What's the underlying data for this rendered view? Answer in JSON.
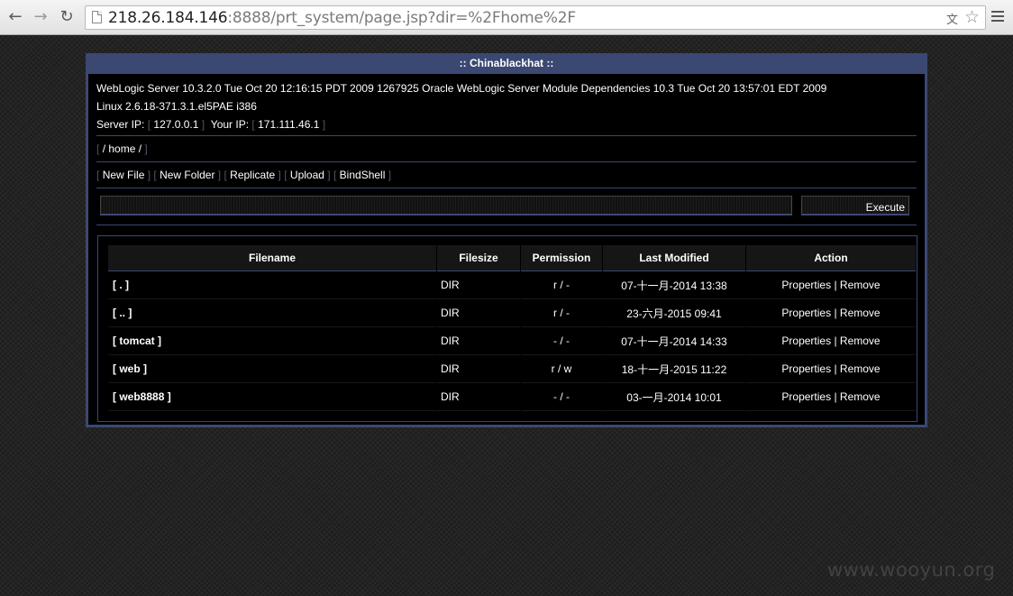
{
  "browser": {
    "url_host": "218.26.184.146",
    "url_rest": ":8888/prt_system/page.jsp?dir=%2Fhome%2F"
  },
  "panel": {
    "title": ":: Chinablackhat ::",
    "server_info": "WebLogic Server 10.3.2.0 Tue Oct 20 12:16:15 PDT 2009 1267925 Oracle WebLogic Server Module Dependencies 10.3 Tue Oct 20 13:57:01 EDT 2009",
    "os_info": "Linux 2.6.18-371.3.1.el5PAE i386",
    "server_ip_label": "Server IP:",
    "server_ip": "127.0.0.1",
    "your_ip_label": "Your IP:",
    "your_ip": "171.111.46.1",
    "path": "/ home /",
    "toolbar": [
      "New File",
      "New Folder",
      "Replicate",
      "Upload",
      "BindShell"
    ],
    "execute_label": "Execute"
  },
  "table": {
    "headers": [
      "Filename",
      "Filesize",
      "Permission",
      "Last Modified",
      "Action"
    ],
    "rows": [
      {
        "name": "[ . ]",
        "size": "DIR",
        "perm": "r / -",
        "modified": "07-十一月-2014 13:38",
        "properties": "Properties",
        "remove": "Remove"
      },
      {
        "name": "[ .. ]",
        "size": "DIR",
        "perm": "r / -",
        "modified": "23-六月-2015 09:41",
        "properties": "Properties",
        "remove": "Remove"
      },
      {
        "name": "[ tomcat ]",
        "size": "DIR",
        "perm": "- / -",
        "modified": "07-十一月-2014 14:33",
        "properties": "Properties",
        "remove": "Remove"
      },
      {
        "name": "[ web ]",
        "size": "DIR",
        "perm": "r / w",
        "modified": "18-十一月-2015 11:22",
        "properties": "Properties",
        "remove": "Remove"
      },
      {
        "name": "[ web8888 ]",
        "size": "DIR",
        "perm": "- / -",
        "modified": "03-一月-2014 10:01",
        "properties": "Properties",
        "remove": "Remove"
      }
    ]
  },
  "watermark": "www.wooyun.org"
}
